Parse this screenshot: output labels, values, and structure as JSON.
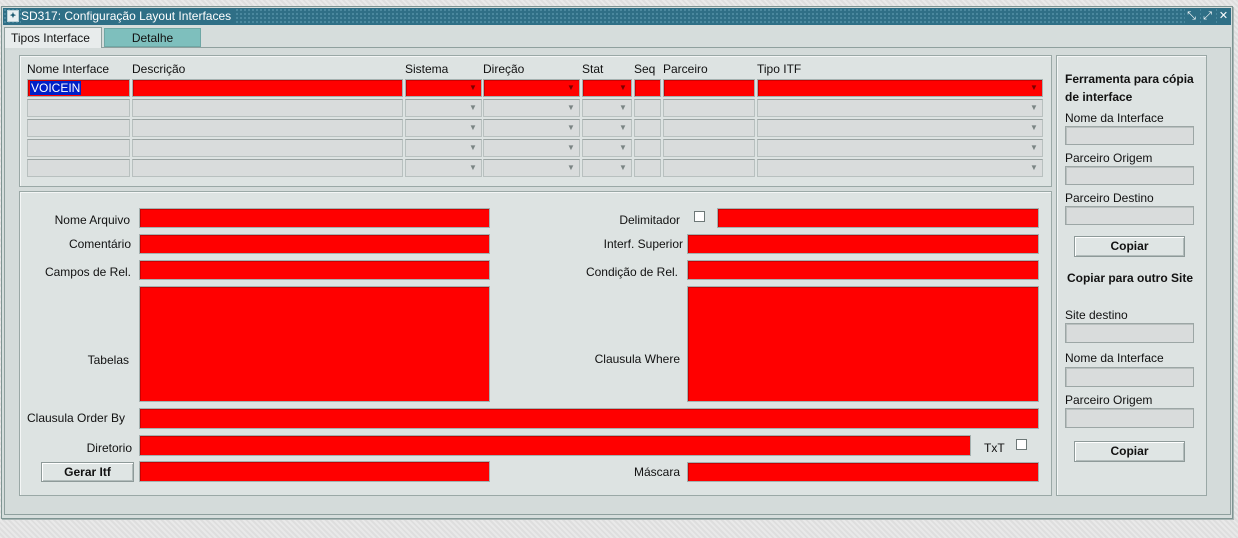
{
  "window": {
    "title": "SD317: Configuração Layout Interfaces"
  },
  "tabs": [
    {
      "label": "Tipos Interface",
      "active": true
    },
    {
      "label": "Detalhe",
      "active": false
    }
  ],
  "grid": {
    "headers": [
      "Nome Interface",
      "Descrição",
      "Sistema",
      "Direção",
      "Stat",
      "Seq",
      "Parceiro",
      "Tipo ITF"
    ],
    "rows": [
      {
        "nome_interface": "VOICEIN",
        "descricao": "",
        "sistema": "",
        "direcao": "",
        "stat": "",
        "seq": "",
        "parceiro": "",
        "tipo_itf": ""
      }
    ]
  },
  "detail": {
    "nome_arquivo_label": "Nome Arquivo",
    "comentario_label": "Comentário",
    "campos_rel_label": "Campos de Rel.",
    "tabelas_label": "Tabelas",
    "clausula_order_label": "Clausula Order By",
    "diretorio_label": "Diretorio",
    "gerar_itf_label": "Gerar Itf",
    "delimitador_label": "Delimitador",
    "interf_superior_label": "Interf. Superior",
    "condicao_rel_label": "Condição de Rel.",
    "clausula_where_label": "Clausula Where",
    "txt_label": "TxT",
    "mascara_label": "Máscara"
  },
  "tool": {
    "title": "Ferramenta para cópia de interface",
    "nome_interface_label": "Nome da Interface",
    "parceiro_origem_label": "Parceiro Origem",
    "parceiro_destino_label": "Parceiro Destino",
    "copiar_label": "Copiar"
  },
  "copy_site": {
    "title": "Copiar para outro Site",
    "site_destino_label": "Site destino",
    "nome_interface_label": "Nome da Interface",
    "parceiro_origem_label": "Parceiro Origem",
    "copiar_label": "Copiar"
  },
  "colors": {
    "required": "#ff0000",
    "titlebar": "#2f6f86",
    "tab_inactive": "#7ebfbd",
    "selection": "#0020c8"
  },
  "icons": [
    "app-icon",
    "minimize-icon",
    "maximize-icon",
    "close-icon",
    "dropdown-arrow-icon"
  ]
}
